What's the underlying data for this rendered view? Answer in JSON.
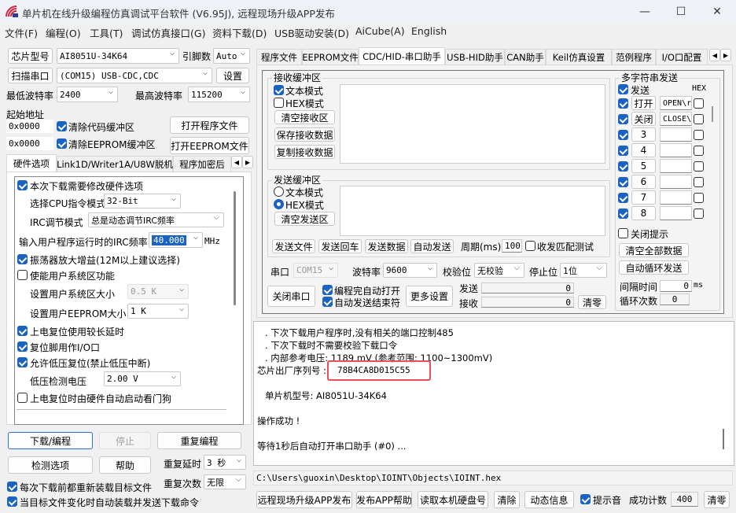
{
  "window": {
    "title": "单片机在线升级编程仿真调试平台软件 (V6.95J), 远程现场升级APP发布",
    "minimize": "—",
    "maximize": "☐",
    "close": "✕"
  },
  "menu": [
    "文件(F)",
    "编程(O)",
    "工具(T)",
    "调试仿真接口(G)",
    "资料下载(D)",
    "USB驱动安装(D)",
    "AiCube(A)",
    "English"
  ],
  "left": {
    "chip_button": "芯片型号",
    "chip_value": "AI8051U-34K64",
    "pins_label": "引脚数",
    "pins_value": "Auto",
    "scan_button": "扫描串口",
    "port_value": "(COM15) USB-CDC,CDC",
    "settings_button": "设置",
    "min_baud_label": "最低波特率",
    "min_baud": "2400",
    "max_baud_label": "最高波特率",
    "max_baud": "115200",
    "start_addr_label": "起始地址",
    "addr1": "0x0000",
    "addr2": "0x0000",
    "clear_code": "清除代码缓冲区",
    "clear_eeprom": "清除EEPROM缓冲区",
    "open_program": "打开程序文件",
    "open_eeprom": "打开EEPROM文件",
    "tabs": [
      "硬件选项",
      "Link1D/Writer1A/U8W脱机",
      "程序加密后"
    ],
    "hw": {
      "modify": "本次下载需要修改硬件选项",
      "cpu_label": "选择CPU指令模式",
      "cpu_value": "32-Bit",
      "irc_label": "IRC调节模式",
      "irc_value": "总是动态调节IRC频率",
      "freq_label": "输入用户程序运行时的IRC频率",
      "freq_value": "40.000",
      "freq_unit": "MHz",
      "osc": "振荡器放大增益(12M以上建议选择)",
      "sysarea": "使能用户系统区功能",
      "sysarea_size_label": "设置用户系统区大小",
      "sysarea_size": "0.5 K",
      "eeprom_size_label": "设置用户EEPROM大小",
      "eeprom_size": "1   K",
      "long_delay": "上电复位使用较长延时",
      "reset_io": "复位脚用作I/O口",
      "lvr": "允许低压复位(禁止低压中断)",
      "lv_label": "低压检测电压",
      "lv_value": "2.00 V",
      "wdt": "上电复位时由硬件自动启动看门狗"
    },
    "download": "下载/编程",
    "stop": "停止",
    "repeat": "重复编程",
    "check": "检测选项",
    "help": "帮助",
    "repeat_delay_label": "重复延时",
    "repeat_delay": "3 秒",
    "repeat_count_label": "重复次数",
    "repeat_count": "无限",
    "reload": "每次下载前都重新装载目标文件",
    "auto_load": "当目标文件变化时自动装载并发送下载命令"
  },
  "right": {
    "tabs": [
      "程序文件",
      "EEPROM文件",
      "CDC/HID-串口助手",
      "USB-HID助手",
      "CAN助手",
      "Keil仿真设置",
      "范例程序",
      "I/O口配置"
    ],
    "recv": {
      "title": "接收缓冲区",
      "text_mode": "文本模式",
      "hex_mode": "HEX模式",
      "clear": "清空接收区",
      "save": "保存接收数据",
      "copy": "复制接收数据"
    },
    "send": {
      "title": "发送缓冲区",
      "text_mode": "文本模式",
      "hex_mode": "HEX模式",
      "clear": "清空发送区",
      "send_file": "发送文件",
      "send_enter": "发送回车",
      "send_data": "发送数据",
      "auto_send": "自动发送",
      "period_label": "周期(ms)",
      "period": "100",
      "match_test": "收发匹配测试"
    },
    "serial": {
      "port_label": "串口",
      "port": "COM15",
      "baud_label": "波特率",
      "baud": "9600",
      "parity_label": "校验位",
      "parity": "无校验",
      "stop_label": "停止位",
      "stop": "1位",
      "close_port": "关闭串口",
      "auto_open": "编程完自动打开",
      "auto_end": "自动发送结束符",
      "more": "更多设置",
      "sent_label": "发送",
      "sent": "0",
      "recv_label": "接收",
      "recv": "0",
      "clear": "清零"
    },
    "multi": {
      "title": "多字符串发送",
      "send": "发送",
      "hex": "HEX",
      "rows": [
        {
          "btn": "打开",
          "val": "OPEN\\r"
        },
        {
          "btn": "关闭",
          "val": "CLOSE\\"
        },
        {
          "btn": "3",
          "val": ""
        },
        {
          "btn": "4",
          "val": ""
        },
        {
          "btn": "5",
          "val": ""
        },
        {
          "btn": "6",
          "val": ""
        },
        {
          "btn": "7",
          "val": ""
        },
        {
          "btn": "8",
          "val": ""
        }
      ],
      "close_tip": "关闭提示",
      "clear_all": "清空全部数据",
      "auto_loop": "自动循环发送",
      "interval_label": "间隔时间",
      "interval": "0",
      "interval_unit": "ms",
      "loop_label": "循环次数",
      "loop": "0"
    }
  },
  "log": {
    "lines": [
      ". 下次下载用户程序时,没有相关的端口控制485",
      ". 下次下载时不需要校验下载口令",
      ". 内部参考电压: 1189 mV (参考范围: 1100~1300mV)"
    ],
    "serial_label": "芯片出厂序列号 :",
    "serial": "78B4CA8D015C55",
    "model": "单片机型号: AI8051U-34K64",
    "success": "操作成功 !",
    "waiting": "等待1秒后自动打开串口助手 (#0) ..."
  },
  "path": "C:\\Users\\guoxin\\Desktop\\IOINT\\Objects\\IOINT.hex",
  "bottom": {
    "publish": "远程现场升级APP发布",
    "publish_help": "发布APP帮助",
    "read_disk": "读取本机硬盘号",
    "clear": "清除",
    "dynamic": "动态信息",
    "sound": "提示音",
    "count_label": "成功计数",
    "count": "400",
    "reset": "清零"
  },
  "colors": {
    "accent": "#1a63c2",
    "highlight": "#e8505b"
  }
}
